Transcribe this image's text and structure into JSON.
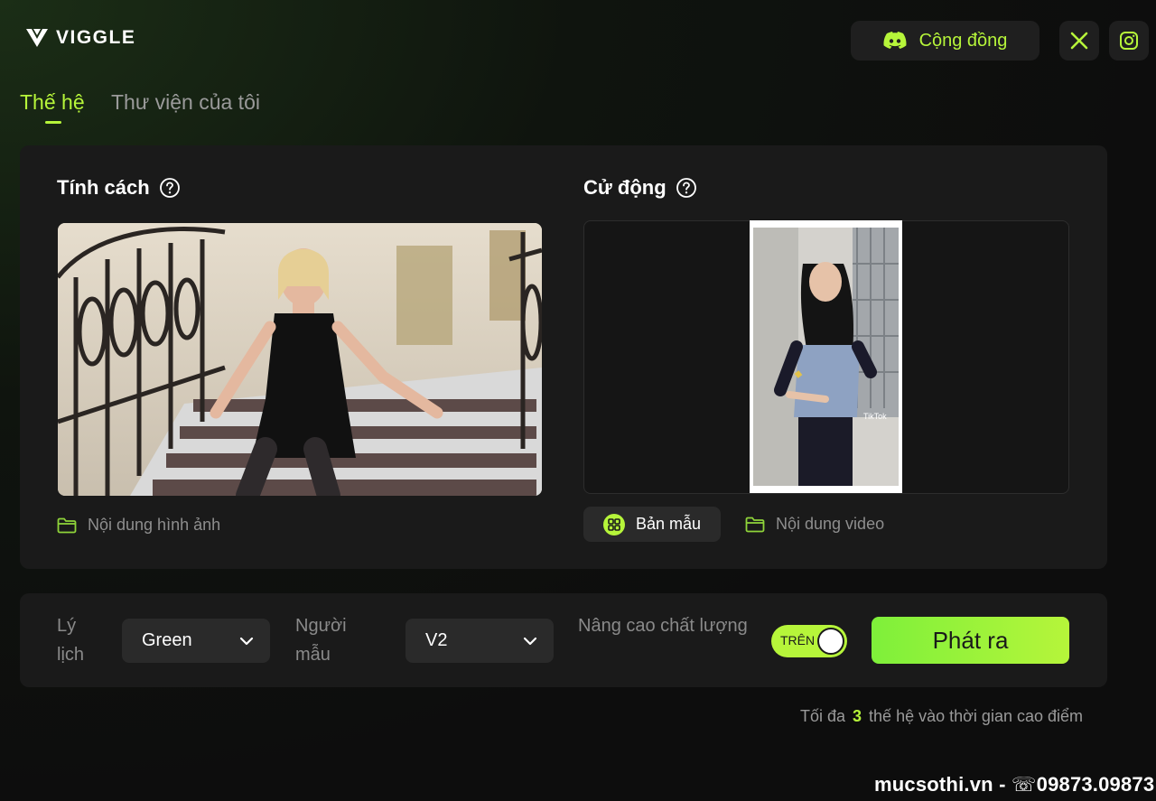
{
  "brand": {
    "name": "VIGGLE"
  },
  "header": {
    "community_label": "Cộng đồng",
    "community_icon": "discord-icon",
    "x_icon": "x-twitter-icon",
    "instagram_icon": "instagram-icon"
  },
  "tabs": [
    {
      "label": "Thế hệ",
      "active": true
    },
    {
      "label": "Thư viện của tôi",
      "active": false
    }
  ],
  "character": {
    "title": "Tính cách",
    "content_link": "Nội dung hình ảnh"
  },
  "motion": {
    "title": "Cử động",
    "template_label": "Bản mẫu",
    "content_link": "Nội dung video",
    "video_watermark": "TikTok"
  },
  "settings": {
    "profile_label": "Lý lịch",
    "profile_value": "Green",
    "model_label": "Người mẫu",
    "model_value": "V2",
    "quality_label": "Nâng cao chất lượng",
    "quality_toggle_label": "TRÊN",
    "quality_on": true,
    "generate_label": "Phát ra"
  },
  "footnote": {
    "prefix": "Tối đa",
    "count": "3",
    "suffix": "thế hệ vào thời gian cao điểm"
  },
  "watermark": "mucsothi.vn - ☏09873.09873",
  "colors": {
    "accent": "#b6f53a",
    "background": "#0d0d0d",
    "card": "#1a1a1a",
    "control": "#2a2a2a"
  }
}
